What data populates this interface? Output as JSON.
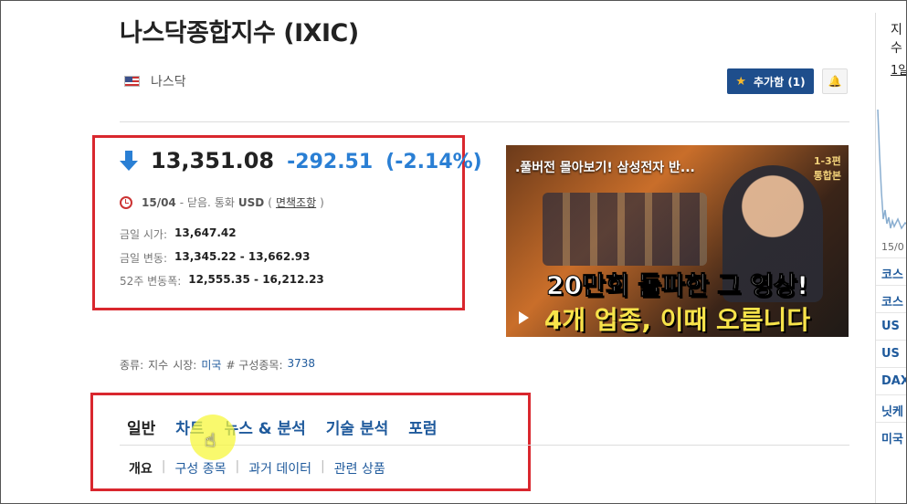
{
  "header": {
    "title": "나스닥종합지수 (IXIC)",
    "exchange": "나스닥",
    "add_button_label": "추가함 (1)",
    "flag_icon": "us-flag-icon",
    "bell_icon": "bell-plus-icon"
  },
  "quote": {
    "price": "13,351.08",
    "change": "-292.51",
    "change_pct": "(-2.14%)",
    "date": "15/04",
    "status": "- 닫음.",
    "currency_label": "통화",
    "currency": "USD",
    "disclaimer_open": "(",
    "disclaimer": "면책조항",
    "disclaimer_close": ")",
    "stats": [
      {
        "label": "금일 시가:",
        "value": "13,647.42"
      },
      {
        "label": "금일 변동:",
        "value": "13,345.22 - 13,662.93"
      },
      {
        "label": "52주 변동폭:",
        "value": "12,555.35 - 16,212.23"
      }
    ]
  },
  "video": {
    "title": ".풀버전 몰아보기! 삼성전자 반...",
    "badge_line1": "1-3편",
    "badge_line2": "통합본",
    "caption1": "20만회 돌파한 그 영상!",
    "caption2": "4개 업종, 이때 오릅니다"
  },
  "category": {
    "type_label": "종류:",
    "type_value": "지수",
    "market_label": "시장:",
    "market_value": "미국",
    "components_label": "# 구성종목:",
    "components_value": "3738"
  },
  "tabs": [
    "일반",
    "차트",
    "뉴스 & 분석",
    "기술 분석",
    "포럼"
  ],
  "subtabs": [
    "개요",
    "구성 종목",
    "과거 데이터",
    "관련 상품"
  ],
  "sidebar": {
    "tab": "지수",
    "tab2": "1일",
    "date": "15/0",
    "items": [
      "코스",
      "코스",
      "US",
      "US",
      "DAX",
      "닛케",
      "미국"
    ]
  },
  "colors": {
    "accent": "#1e4e8c",
    "down": "#2a7fd4",
    "highlight_border": "#d9272e"
  }
}
